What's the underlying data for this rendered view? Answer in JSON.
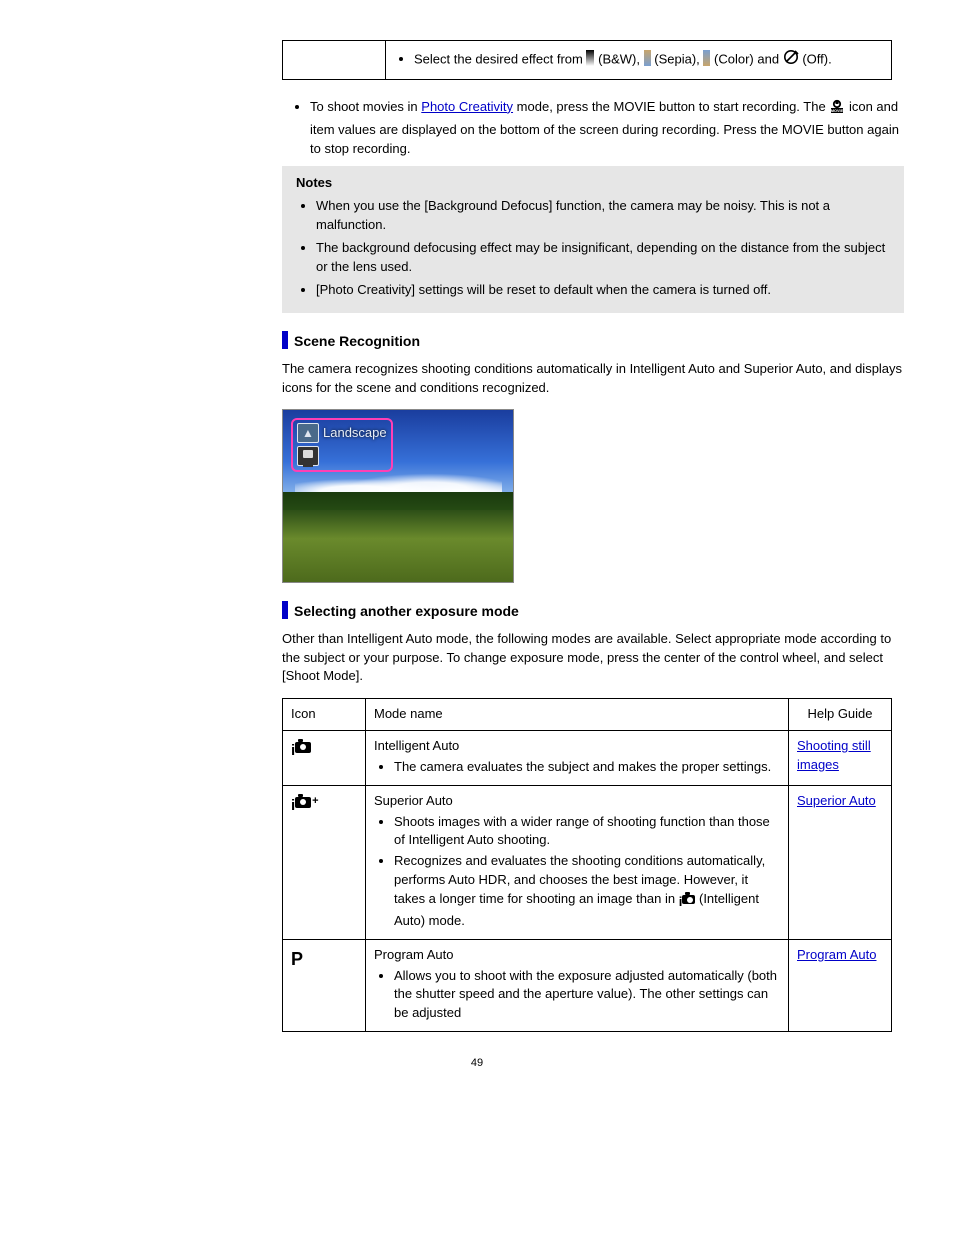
{
  "creative": {
    "bullet": "Select the desired effect from",
    "opt_bw": "  (B&W),",
    "opt_sepia": "  (Sepia),",
    "opt_color": "  (Color) and",
    "opt_off": "  (Off)."
  },
  "movie_note": {
    "text1": "To shoot movies in ",
    "link": "Photo Creativity",
    "text2": " mode, press the MOVIE button to start recording. The",
    "iconlabel": " icon and item values are displayed on the bottom of the screen during recording. Press the MOVIE button again to stop recording."
  },
  "notes": {
    "heading": "Notes",
    "items": [
      "When you use the [Background Defocus] function, the camera may be noisy. This is not a malfunction.",
      "The background defocusing effect may be insignificant, depending on the distance from the subject or the lens used.",
      "[Photo Creativity] settings will be reset to default when the camera is turned off."
    ]
  },
  "scene": {
    "heading": "Scene Recognition",
    "para": "The camera recognizes shooting conditions automatically in Intelligent Auto and Superior Auto, and displays icons for the scene and conditions recognized."
  },
  "modes": {
    "heading": "Selecting another exposure mode",
    "para": "Other than Intelligent Auto mode, the following modes are available. Select appropriate mode according to the subject or your purpose. To change exposure mode, press the center of the control wheel, and select [Shoot Mode].",
    "cols": {
      "icon": "Icon",
      "name": "Mode name",
      "guide": "Help Guide"
    },
    "rows": [
      {
        "icon": "iAuto",
        "name": "Intelligent Auto",
        "desc": "The camera evaluates the subject and makes the proper settings.",
        "guide": "Shooting still images"
      },
      {
        "icon": "iAutoPlus",
        "name": "Superior Auto",
        "desc1": "Shoots images with a wider range of shooting function than those of Intelligent Auto shooting.",
        "desc2a": "Recognizes and evaluates the shooting conditions automatically, performs Auto HDR, and chooses the best image. However, it takes a longer time for shooting an image than in ",
        "desc2b": " (Intelligent Auto) mode.",
        "guide": "Superior Auto"
      },
      {
        "icon": "P",
        "name": "Program Auto",
        "desc": "Allows you to shoot with the exposure adjusted automatically (both the shutter speed and the aperture value). The other settings can be adjusted",
        "guide": "Program Auto"
      }
    ]
  },
  "pageNumber": "49"
}
